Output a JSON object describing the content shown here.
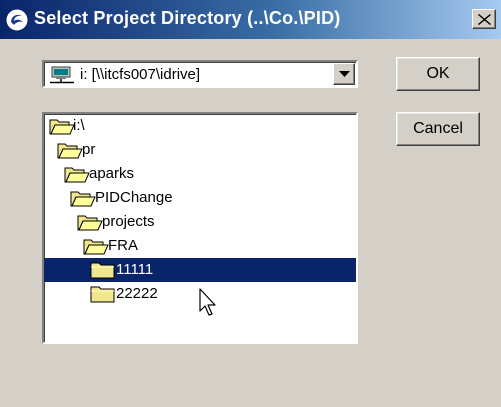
{
  "window": {
    "title": "Select Project Directory (..\\Co.\\PID)",
    "title_icon": "app-swirl-icon",
    "close_glyph": "x-icon"
  },
  "drive_select": {
    "value": "i: [\\\\itcfs007\\idrive]",
    "icon": "network-drive-icon"
  },
  "buttons": {
    "ok_label": "OK",
    "cancel_label": "Cancel"
  },
  "tree": {
    "items": [
      {
        "label": "i:\\",
        "icon": "open-folder-icon",
        "depth": 0,
        "selected": false
      },
      {
        "label": "pr",
        "icon": "open-folder-icon",
        "depth": 1,
        "selected": false
      },
      {
        "label": "aparks",
        "icon": "open-folder-icon",
        "depth": 2,
        "selected": false
      },
      {
        "label": "PIDChange",
        "icon": "open-folder-icon",
        "depth": 3,
        "selected": false
      },
      {
        "label": "projects",
        "icon": "open-folder-icon",
        "depth": 4,
        "selected": false
      },
      {
        "label": "FRA",
        "icon": "open-folder-icon",
        "depth": 5,
        "selected": false
      },
      {
        "label": "11111",
        "icon": "closed-folder-icon",
        "depth": 6,
        "selected": true
      },
      {
        "label": "22222",
        "icon": "closed-folder-icon",
        "depth": 6,
        "selected": false
      }
    ]
  },
  "colors": {
    "dialog_face": "#d4d0c8",
    "titlebar_start": "#0a246a",
    "titlebar_end": "#a6caf0",
    "selection": "#0a246a",
    "folder_yellow": "#f0e68c"
  }
}
